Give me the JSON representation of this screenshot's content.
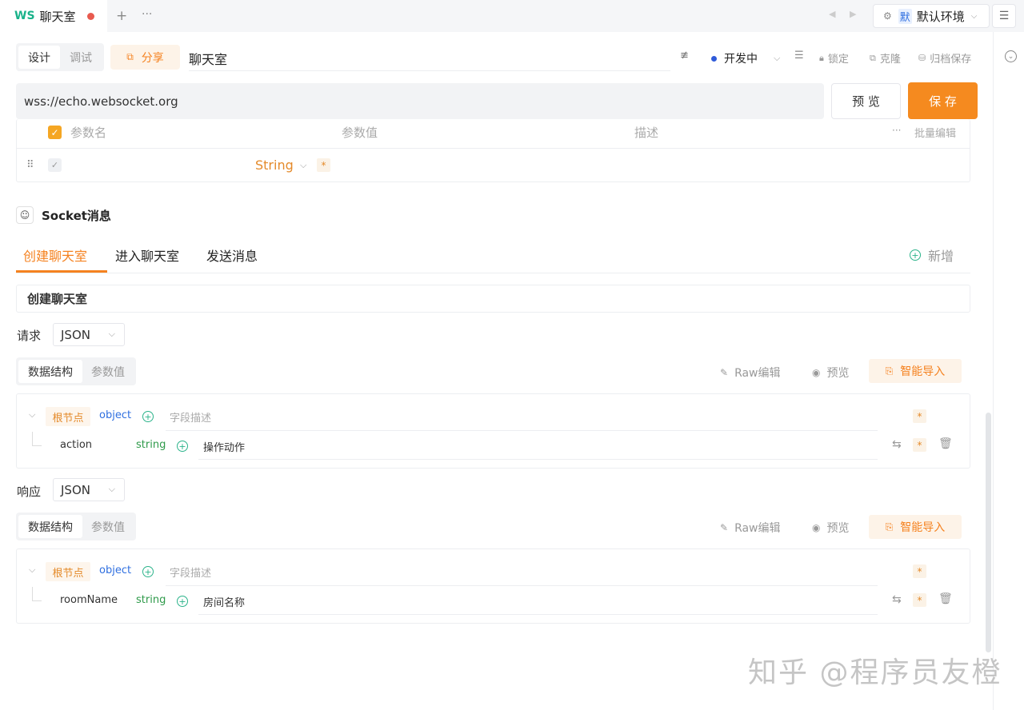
{
  "tab": {
    "prefix": "WS",
    "title": "聊天室"
  },
  "env": {
    "badge": "默",
    "name": "默认环境"
  },
  "mode": {
    "design": "设计",
    "debug": "调试"
  },
  "share": "分享",
  "api_name": "聊天室",
  "status": "开发中",
  "toolbar": {
    "lock": "锁定",
    "clone": "克隆",
    "archive": "归档保存"
  },
  "url": "wss://echo.websocket.org",
  "preview_btn": "预 览",
  "save_btn": "保 存",
  "params": {
    "col_name": "参数名",
    "col_value": "参数值",
    "col_desc": "描述",
    "batch": "批量编辑",
    "row_type": "String"
  },
  "socket": {
    "title": "Socket消息",
    "tabs": [
      "创建聊天室",
      "进入聊天室",
      "发送消息"
    ],
    "add": "新增",
    "current": "创建聊天室"
  },
  "request": {
    "label": "请求",
    "format": "JSON",
    "seg": [
      "数据结构",
      "参数值"
    ],
    "raw": "Raw编辑",
    "preview": "预览",
    "smart": "智能导入",
    "root": "根节点",
    "root_type": "object",
    "root_desc_placeholder": "字段描述",
    "field": {
      "name": "action",
      "type": "string",
      "desc": "操作动作"
    }
  },
  "response": {
    "label": "响应",
    "format": "JSON",
    "seg": [
      "数据结构",
      "参数值"
    ],
    "raw": "Raw编辑",
    "preview": "预览",
    "smart": "智能导入",
    "root": "根节点",
    "root_type": "object",
    "root_desc_placeholder": "字段描述",
    "field": {
      "name": "roomName",
      "type": "string",
      "desc": "房间名称"
    }
  },
  "watermark": "知乎 @程序员友橙"
}
